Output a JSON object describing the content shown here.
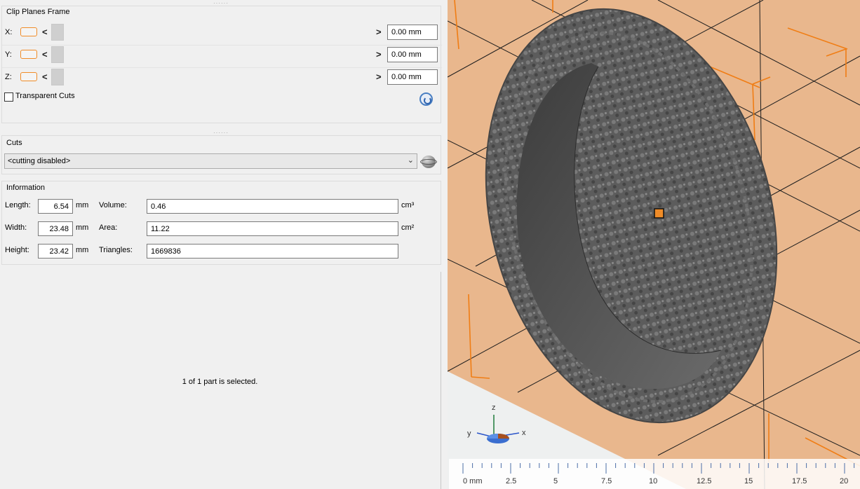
{
  "clip_planes": {
    "title": "Clip Planes Frame",
    "rows": [
      {
        "axis": "X:",
        "value": "0.00 mm"
      },
      {
        "axis": "Y:",
        "value": "0.00 mm"
      },
      {
        "axis": "Z:",
        "value": "0.00 mm"
      }
    ],
    "arrow_left": "<",
    "arrow_right": ">",
    "transparent_cuts_label": "Transparent Cuts",
    "transparent_cuts_checked": false
  },
  "cuts": {
    "title": "Cuts",
    "selected": "<cutting disabled>"
  },
  "information": {
    "title": "Information",
    "length_label": "Length:",
    "length_value": "6.54",
    "width_label": "Width:",
    "width_value": "23.48",
    "height_label": "Height:",
    "height_value": "23.42",
    "unit_mm": "mm",
    "volume_label": "Volume:",
    "volume_value": "0.46",
    "volume_unit": "cm³",
    "area_label": "Area:",
    "area_value": "11.22",
    "area_unit": "cm²",
    "triangles_label": "Triangles:",
    "triangles_value": "1669836"
  },
  "selection_status": "1 of 1 part is selected.",
  "viewport": {
    "background_color": "#e9b78d",
    "model_color": "#5a5a5a",
    "axis_labels": {
      "x": "x",
      "y": "y",
      "z": "z"
    },
    "ruler": {
      "labels": [
        "0 mm",
        "2.5",
        "5",
        "7.5",
        "10",
        "12.5",
        "15",
        "17.5",
        "20"
      ]
    }
  }
}
